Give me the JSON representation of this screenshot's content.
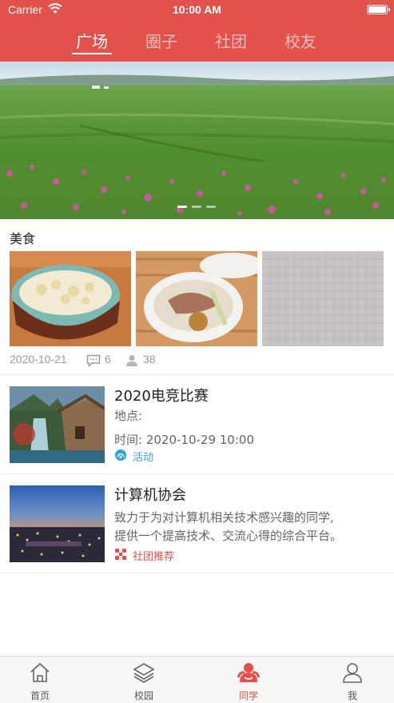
{
  "status_bar": {
    "carrier": "Carrier",
    "time": "10:00 AM"
  },
  "top_tabs": [
    {
      "label": "广场",
      "active": true
    },
    {
      "label": "圈子",
      "active": false
    },
    {
      "label": "社团",
      "active": false
    },
    {
      "label": "校友",
      "active": false
    }
  ],
  "banner": {
    "page_count": 3,
    "active_index": 0
  },
  "food_section": {
    "title": "美食",
    "date": "2020-10-21",
    "comments": "6",
    "views": "38"
  },
  "event_item": {
    "title": "2020电竞比赛",
    "location_label": "地点:",
    "time_text": "时间: 2020-10-29 10:00",
    "tag": "活动"
  },
  "club_item": {
    "title": "计算机协会",
    "desc_line1": "致力于为对计算机相关技术感兴趣的同学,",
    "desc_line2": "提供一个提高技术、交流心得的综合平台。",
    "tag": "社团推荐"
  },
  "bottom_nav": [
    {
      "label": "首页",
      "icon": "home-icon",
      "active": false
    },
    {
      "label": "校园",
      "icon": "layers-icon",
      "active": false
    },
    {
      "label": "同学",
      "icon": "classmates-icon",
      "active": true
    },
    {
      "label": "我",
      "icon": "person-icon",
      "active": false
    }
  ],
  "colors": {
    "accent": "#e2514c",
    "activity_tag": "#2aa6d8",
    "club_tag": "#e2514c"
  }
}
